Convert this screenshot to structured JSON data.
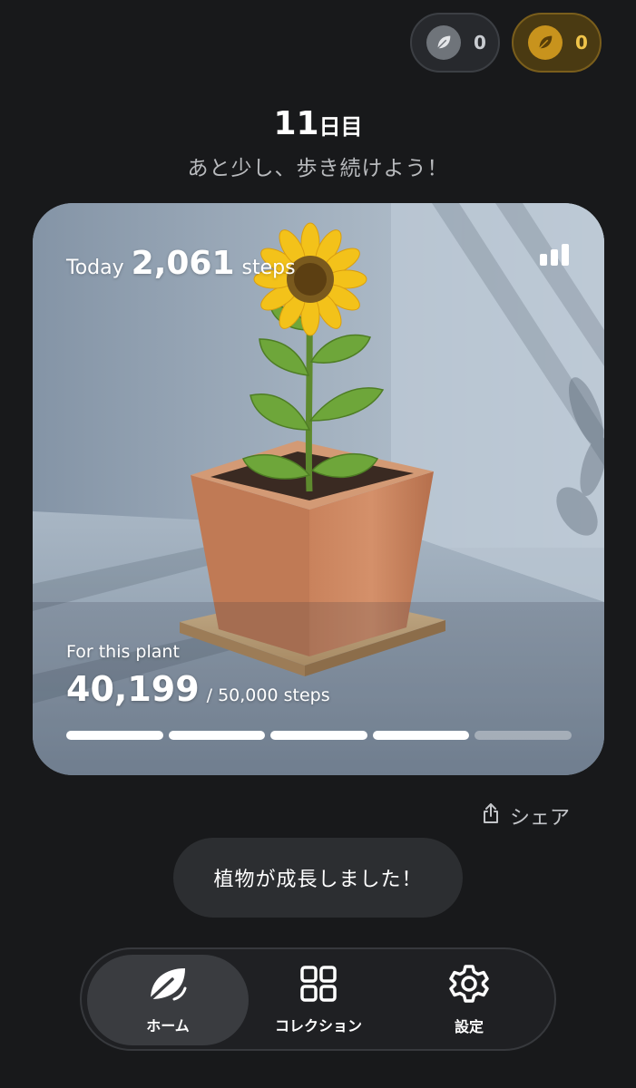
{
  "currency": {
    "silver_leaf": {
      "icon": "silver-leaf-icon",
      "count": "0",
      "color": "#6f747a"
    },
    "gold_leaf": {
      "icon": "gold-leaf-icon",
      "count": "0",
      "color": "#c8931d"
    }
  },
  "header": {
    "day_number": "11",
    "day_suffix": "日目",
    "subtitle": "あと少し、歩き続けよう！"
  },
  "card": {
    "today_label": "Today",
    "today_steps": "2,061",
    "today_unit": "steps",
    "stats_icon": "bar-chart-icon",
    "plant_label": "For this plant",
    "plant_steps": "40,199",
    "plant_goal": "/ 50,000 steps",
    "progress_fraction": 0.804,
    "segments_total": 5,
    "segments_filled": 4
  },
  "share": {
    "label": "シェア",
    "icon": "share-icon"
  },
  "toast": {
    "message": "植物が成長しました！"
  },
  "tabs": [
    {
      "label": "ホーム",
      "icon": "leaf-icon",
      "active": true
    },
    {
      "label": "コレクション",
      "icon": "grid-icon",
      "active": false
    },
    {
      "label": "設定",
      "icon": "gear-icon",
      "active": false
    }
  ]
}
